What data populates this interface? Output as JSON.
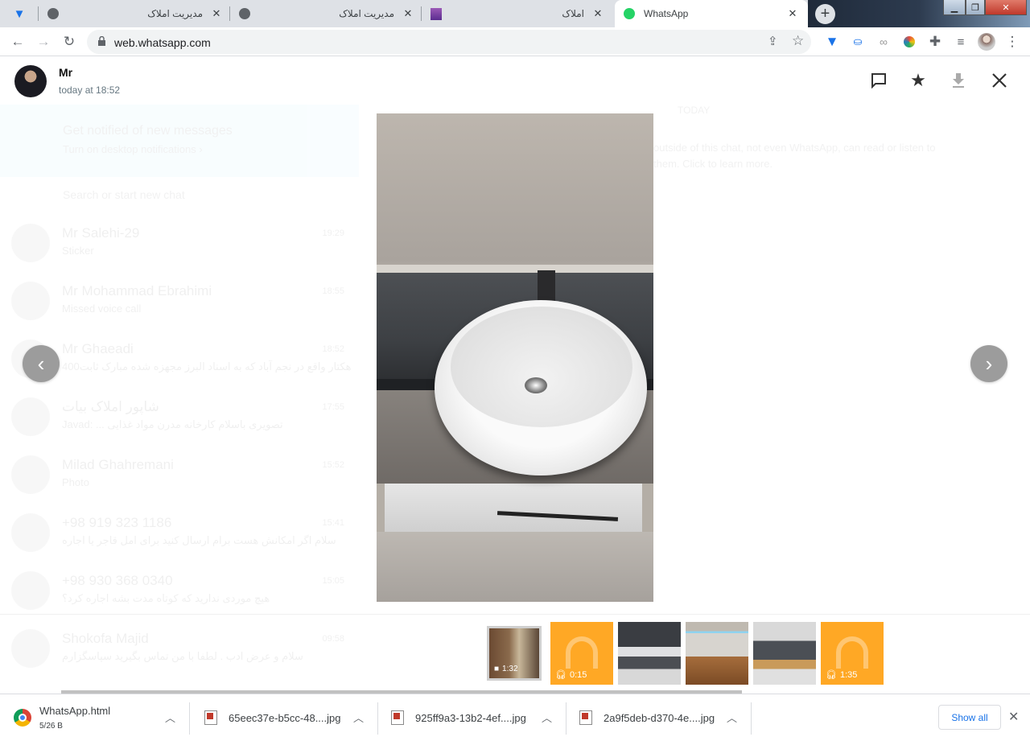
{
  "browser": {
    "tabs": [
      {
        "title": "",
        "icon": "diamond-extension-icon"
      },
      {
        "title": "مدیریت املاک",
        "icon": "globe-icon"
      },
      {
        "title": "مدیریت املاک",
        "icon": "globe-icon"
      },
      {
        "title": "املاک",
        "icon": "building-icon"
      },
      {
        "title": "WhatsApp",
        "icon": "whatsapp-icon",
        "active": true
      }
    ],
    "url": "web.whatsapp.com"
  },
  "viewer": {
    "sender": "Mr",
    "timestamp": "today at 18:52",
    "thumbnails": [
      {
        "type": "video",
        "duration": "1:32",
        "selected": true
      },
      {
        "type": "audio",
        "duration": "0:15"
      },
      {
        "type": "image"
      },
      {
        "type": "image"
      },
      {
        "type": "image"
      },
      {
        "type": "audio",
        "duration": "1:35"
      }
    ],
    "audio_color": "#ffa825"
  },
  "background": {
    "notification_title": "Get notified of new messages",
    "notification_sub": "Turn on desktop notifications ›",
    "search_placeholder": "Search or start new chat",
    "chats": [
      {
        "name": "Mr Salehi-29",
        "preview": "Sticker",
        "time": "19:29"
      },
      {
        "name": "Mr Mohammad Ebrahimi",
        "preview": "Missed voice call",
        "time": "18:55"
      },
      {
        "name": "Mr Ghaeadi",
        "preview": "400هکتار واقع در نجم آباد که به اسناد البرز مجهزه شده مبارک ثابت",
        "time": "18:52"
      },
      {
        "name": "شاپور املاک بیات",
        "preview": "Javad: ... تصویری باسلام کارخانه مدرن مواد غذایی",
        "time": "17:55"
      },
      {
        "name": "Milad Ghahremani",
        "preview": "Photo",
        "time": "15:52"
      },
      {
        "name": "+98 919 323 1186",
        "preview": "سلام اگر امکانش هست برام ارسال کنید برای امل قاجر یا اجاره",
        "time": "15:41"
      },
      {
        "name": "+98 930 368 0340",
        "preview": "هیچ موردی ندارید که کوتاه مدت بشه اجاره کرد؟",
        "time": "15:05"
      },
      {
        "name": "Shokofa Majid",
        "preview": "سلام و عرض ادب . لطفا با من تماس بگیرید سپاسگزارم",
        "time": "09:58"
      }
    ],
    "today_label": "TODAY",
    "encryption_text": "outside of this chat, not even WhatsApp, can read or listen to them. Click to learn more."
  },
  "downloads": {
    "items": [
      {
        "name": "WhatsApp.html",
        "status": "5/26 B"
      },
      {
        "name": "65eec37e-b5cc-48....jpg"
      },
      {
        "name": "925ff9a3-13b2-4ef....jpg"
      },
      {
        "name": "2a9f5deb-d370-4e....jpg"
      }
    ],
    "show_all": "Show all"
  }
}
